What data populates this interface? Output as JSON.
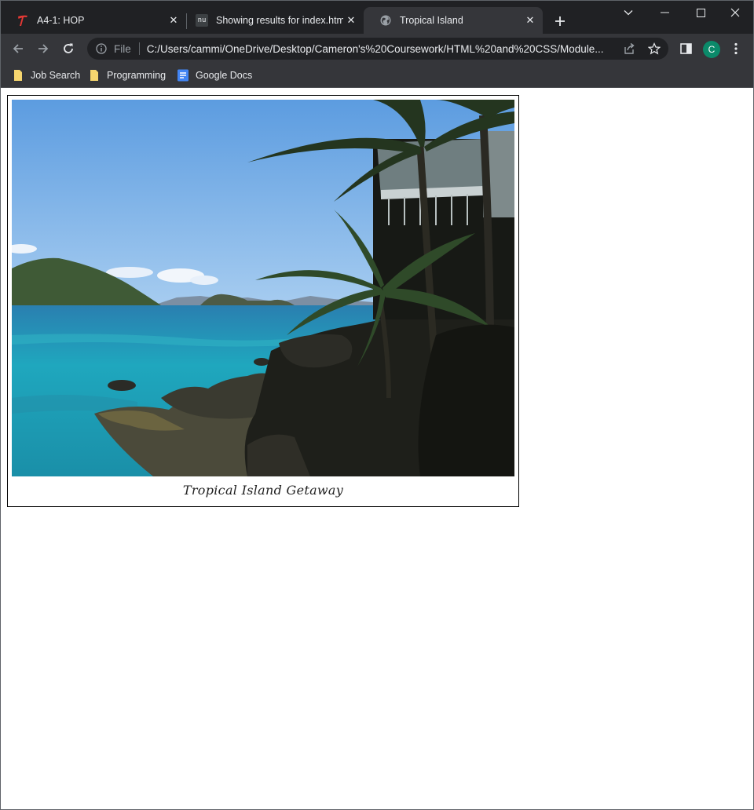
{
  "browser": {
    "tabs": [
      {
        "title": "A4-1: HOP",
        "icon": "brand-t-icon",
        "active": false
      },
      {
        "title": "Showing results for index.html",
        "icon": "nu-validator-icon",
        "favicon_text": "nu",
        "active": false
      },
      {
        "title": "Tropical Island",
        "icon": "globe-icon",
        "active": true
      }
    ],
    "address": {
      "scheme_label": "File",
      "url": "C:/Users/cammi/OneDrive/Desktop/Cameron's%20Coursework/HTML%20and%20CSS/Module..."
    },
    "profile_initial": "C",
    "bookmarks": [
      {
        "label": "Job Search",
        "icon": "folder-icon"
      },
      {
        "label": "Programming",
        "icon": "folder-icon"
      },
      {
        "label": "Google Docs",
        "icon": "google-docs-icon"
      }
    ]
  },
  "page": {
    "figure": {
      "image_alt": "Tropical island shoreline with palm trees",
      "caption": "Tropical Island Getaway"
    }
  },
  "colors": {
    "chrome_dark": "#202124",
    "chrome_toolbar": "#35363a",
    "profile_green": "#0b8a6a",
    "hop_red": "#e53935",
    "docs_blue": "#4285f4",
    "folder_yellow": "#f6d66f"
  }
}
